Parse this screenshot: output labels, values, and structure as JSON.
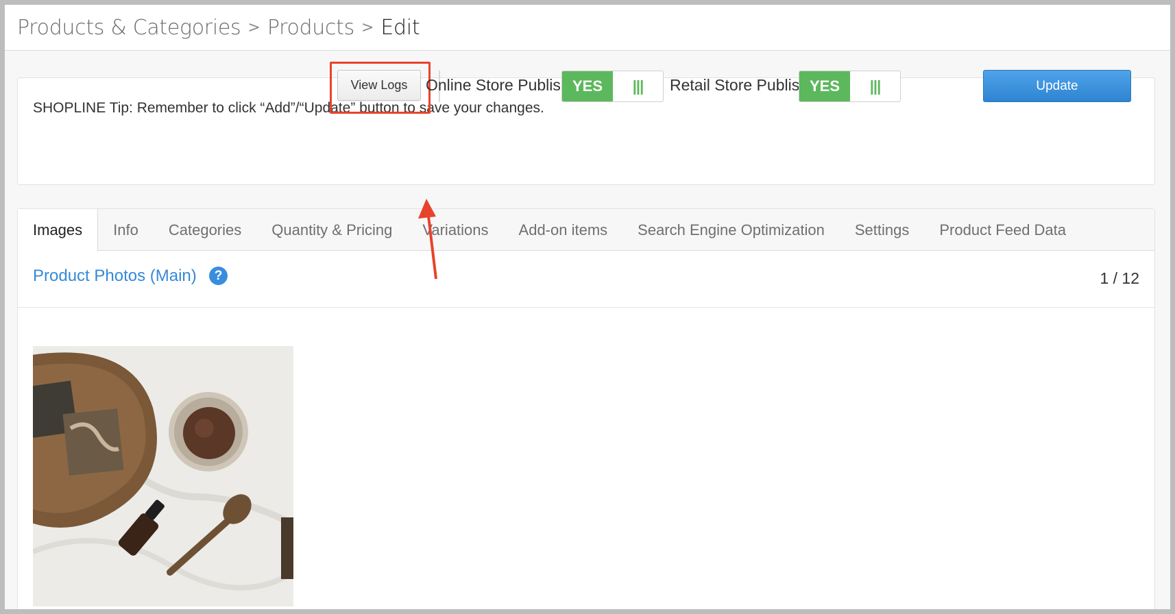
{
  "breadcrumb": {
    "items": [
      "Products & Categories",
      "Products"
    ],
    "current": "Edit",
    "separator": ">"
  },
  "tip": {
    "text": "SHOPLINE Tip: Remember to click “Add”/“Update” button to save your changes."
  },
  "actions": {
    "view_logs_label": "View Logs",
    "online_store_publish_label": "Online Store Publish",
    "online_store_publish_value": "YES",
    "retail_store_publish_label": "Retail Store Publish",
    "retail_store_publish_value": "YES",
    "toggle_handle_glyph": "|||",
    "update_label": "Update"
  },
  "tabs": [
    {
      "label": "Images",
      "active": true
    },
    {
      "label": "Info"
    },
    {
      "label": "Categories"
    },
    {
      "label": "Quantity & Pricing"
    },
    {
      "label": "Variations"
    },
    {
      "label": "Add-on items"
    },
    {
      "label": "Search Engine Optimization"
    },
    {
      "label": "Settings"
    },
    {
      "label": "Product Feed Data"
    }
  ],
  "photos": {
    "title": "Product Photos (Main)",
    "help_glyph": "?",
    "count": "1 / 12"
  },
  "colors": {
    "accent_blue": "#3589d6",
    "toggle_green": "#5cb85c",
    "highlight_red": "#e8432c"
  }
}
